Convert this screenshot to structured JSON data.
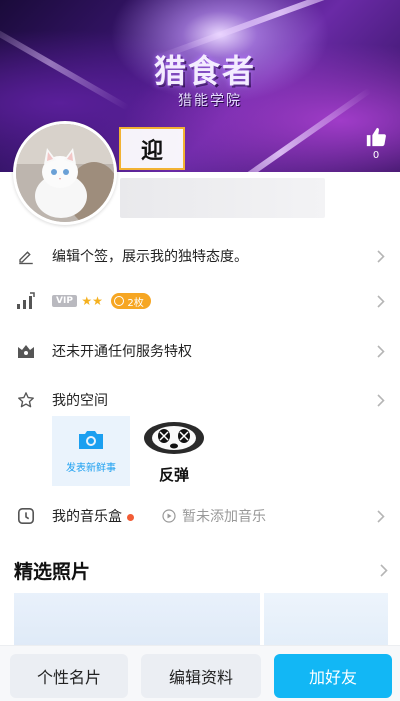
{
  "cover": {
    "title": "猎食者",
    "subtitle": "猎能学院"
  },
  "header": {
    "like_count": "0",
    "name": "迎"
  },
  "rows": {
    "signature": "编辑个签，展示我的独特态度。",
    "vip": {
      "badge": "VIP",
      "coin_label": "2枚"
    },
    "service": "还未开通任何服务特权",
    "space": "我的空间",
    "music_box": "我的音乐盒",
    "music_status": "暂未添加音乐"
  },
  "space_tiles": {
    "post_label": "发表新鲜事",
    "music_label": "反弹"
  },
  "photos": {
    "section_title": "精选照片"
  },
  "bottom": {
    "card_label": "个性名片",
    "edit_label": "编辑资料",
    "add_friend_label": "加好友"
  },
  "colors": {
    "accent": "#12b7f5",
    "name_frame": "#f2b233",
    "coin": "#f6a623",
    "red_dot": "#f25c35"
  }
}
